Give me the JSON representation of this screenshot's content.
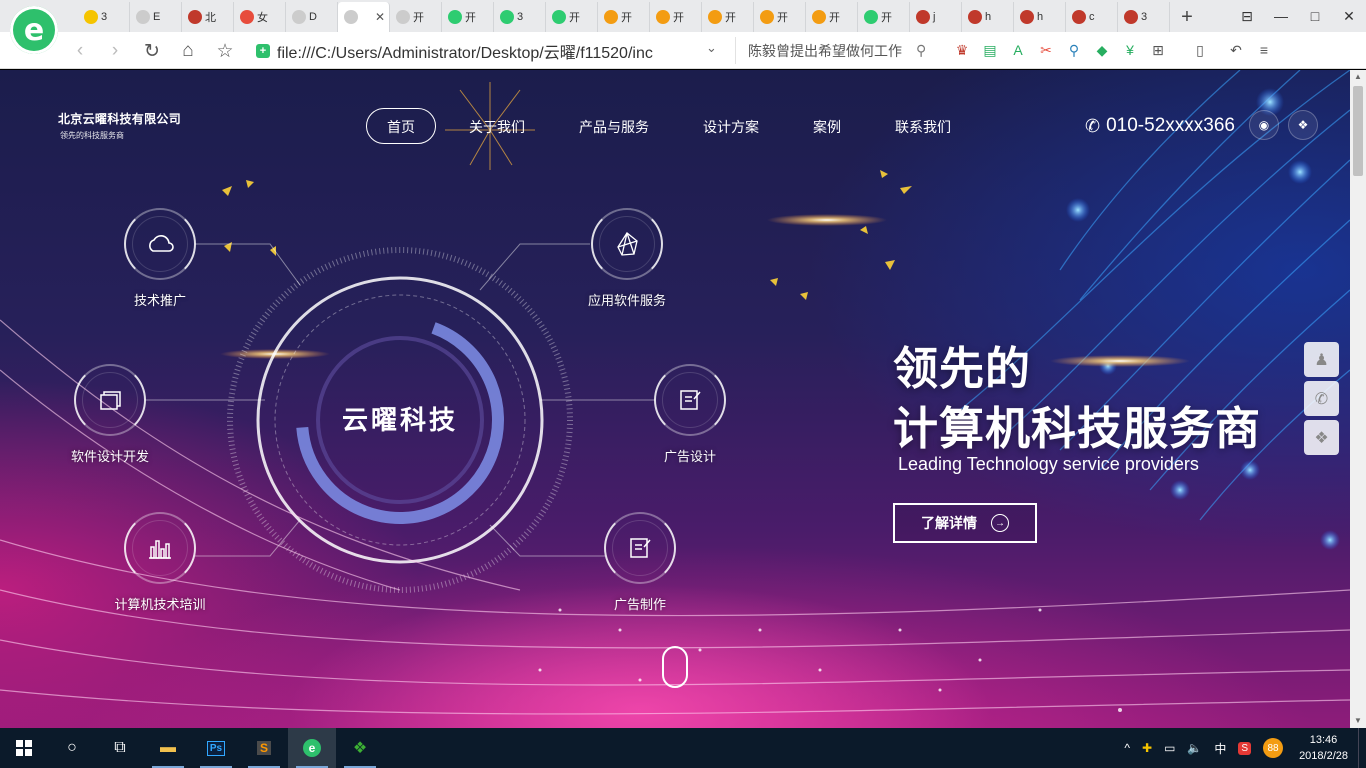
{
  "browser": {
    "logo_glyph": "e",
    "tabs": [
      {
        "label": "3",
        "icon": "plus-badge-icon",
        "color": "#f5c400"
      },
      {
        "label": "E",
        "icon": "page-icon",
        "color": "#cccccc"
      },
      {
        "label": "北",
        "icon": "site-icon",
        "color": "#c0392b"
      },
      {
        "label": "女",
        "icon": "star-site-icon",
        "color": "#e74c3c"
      },
      {
        "label": "D",
        "icon": "page-icon",
        "color": "#cccccc"
      },
      {
        "label": "",
        "icon": "page-icon",
        "color": "#cccccc",
        "active": true,
        "close": "✕"
      },
      {
        "label": "开",
        "icon": "page-icon",
        "color": "#cccccc"
      },
      {
        "label": "开",
        "icon": "search-site-icon",
        "color": "#2ecc71"
      },
      {
        "label": "3",
        "icon": "search-site-icon",
        "color": "#2ecc71"
      },
      {
        "label": "开",
        "icon": "search-site-icon",
        "color": "#2ecc71"
      },
      {
        "label": "开",
        "icon": "b-site-icon",
        "color": "#f39c12"
      },
      {
        "label": "开",
        "icon": "b-site-icon",
        "color": "#f39c12"
      },
      {
        "label": "开",
        "icon": "b-site-icon",
        "color": "#f39c12"
      },
      {
        "label": "开",
        "icon": "b-site-icon",
        "color": "#f39c12"
      },
      {
        "label": "开",
        "icon": "b-site-icon",
        "color": "#f39c12"
      },
      {
        "label": "开",
        "icon": "search-site-icon",
        "color": "#2ecc71"
      },
      {
        "label": "j",
        "icon": "red-site-icon",
        "color": "#c0392b"
      },
      {
        "label": "h",
        "icon": "red-site-icon",
        "color": "#c0392b"
      },
      {
        "label": "h",
        "icon": "red-site-icon",
        "color": "#c0392b"
      },
      {
        "label": "c",
        "icon": "red-site-icon",
        "color": "#c0392b"
      },
      {
        "label": "3",
        "icon": "red-site-icon",
        "color": "#c0392b"
      }
    ],
    "new_tab": "+",
    "address_url": "file:///C:/Users/Administrator/Desktop/云曜/f11520/inc",
    "search_placeholder": "陈毅曾提出希望做何工作",
    "controls": {
      "minimize": "—",
      "maximize": "□",
      "close": "✕",
      "pin": "⊟"
    }
  },
  "site": {
    "brand_name": "北京云曜科技有限公司",
    "brand_slogan": "领先的科技服务商",
    "nav": [
      {
        "label": "首页",
        "active": true
      },
      {
        "label": "关于我们"
      },
      {
        "label": "产品与服务"
      },
      {
        "label": "设计方案"
      },
      {
        "label": "案例"
      },
      {
        "label": "联系我们"
      }
    ],
    "phone": "010-52xxxx366",
    "center_title": "云曜科技",
    "services": [
      {
        "label": "技术推广",
        "icon": "cloud-icon"
      },
      {
        "label": "应用软件服务",
        "icon": "network-icon"
      },
      {
        "label": "软件设计开发",
        "icon": "windows-stack-icon"
      },
      {
        "label": "广告设计",
        "icon": "edit-doc-icon"
      },
      {
        "label": "计算机技术培训",
        "icon": "bar-chart-icon"
      },
      {
        "label": "广告制作",
        "icon": "edit-doc-icon"
      }
    ],
    "hero_line1": "领先的",
    "hero_line2": "计算机科技服务商",
    "hero_en": "Leading Technology service providers",
    "hero_button": "了解详情"
  },
  "taskbar": {
    "time": "13:46",
    "date": "2018/2/28",
    "ime": "中",
    "badge": "88"
  },
  "colors": {
    "page_bg_top": "#1b1d4c",
    "page_bg_bottom": "#8e1c7a",
    "accent_green": "#2ec06c",
    "taskbar": "#0b1a2a"
  }
}
